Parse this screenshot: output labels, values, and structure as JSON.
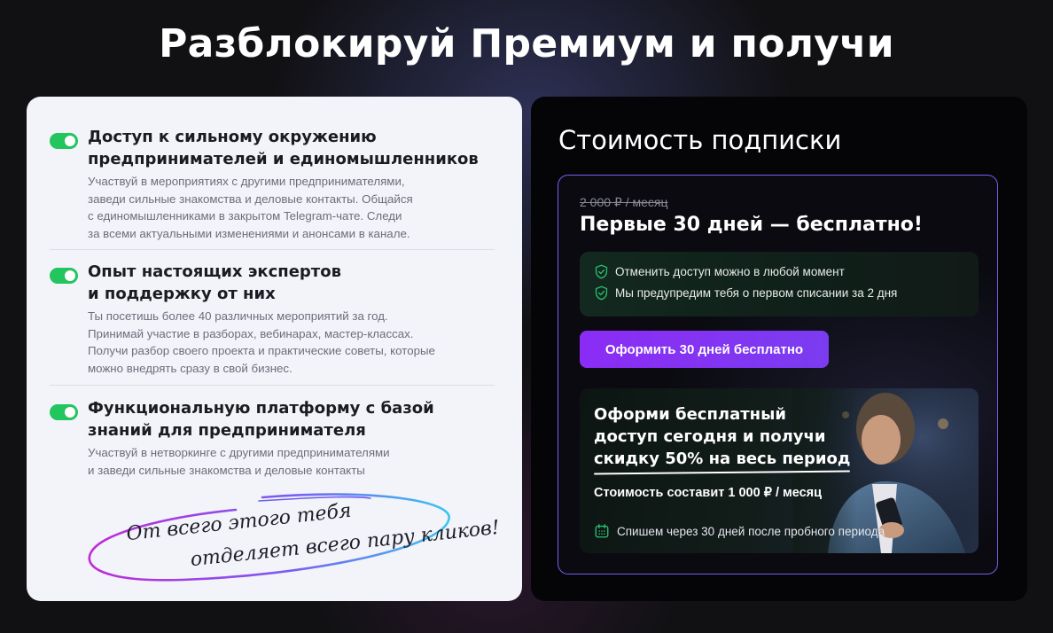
{
  "header": {
    "title": "Разблокируй Премиум и получи"
  },
  "features": [
    {
      "title_line1": "Доступ к сильному окружению",
      "title_line2": "предпринимателей и единомышленников",
      "desc_lines": [
        "Участвуй в мероприятиях с другими предпринимателями,",
        "заведи сильные знакомства и деловые контакты. Общайся",
        "с единомышленниками в закрытом Telegram-чате. Следи",
        "за всеми актуальными изменениями и анонсами в канале."
      ]
    },
    {
      "title_line1": "Опыт настоящих экспертов",
      "title_line2": "и поддержку от них",
      "desc_lines": [
        "Ты посетишь более 40 различных мероприятий за год.",
        "Принимай участие в разборах, вебинарах, мастер-классах.",
        "Получи разбор своего проекта и практические советы, которые",
        "можно внедрять сразу в свой бизнес."
      ]
    },
    {
      "title_line1": "Функциональную платформу с базой",
      "title_line2": "знаний для предпринимателя",
      "desc_lines": [
        "Участвуй в нетворкинге с другими предпринимателями",
        "и заведи сильные знакомства и деловые контакты"
      ]
    }
  ],
  "handwritten": {
    "line1": "От всего этого тебя",
    "line2": "отделяет всего пару кликов!"
  },
  "pricing": {
    "title": "Стоимость подписки",
    "old_price": "2 000 ₽ / месяц",
    "free_title": "Первые 30 дней — бесплатно!",
    "notices": [
      "Отменить доступ можно в любой момент",
      "Мы предупредим тебя о первом списании за 2 дня"
    ],
    "cta_label": "Оформить 30 дней бесплатно",
    "promo": {
      "line1": "Оформи бесплатный",
      "line2": "доступ сегодня и получи",
      "line3": "скидку 50% на весь период",
      "cost": "Стоимость составит 1 000 ₽ / месяц",
      "note": "Спишем через 30 дней после пробного периода"
    }
  },
  "colors": {
    "toggle": "#22c55e",
    "accent_purple": "#8b2cf5",
    "border_purple": "#7b5cf0",
    "shield_green": "#2bbf73"
  },
  "icons": {
    "toggle": "toggle-on-icon",
    "shield": "shield-check-icon",
    "calendar": "calendar-icon"
  }
}
